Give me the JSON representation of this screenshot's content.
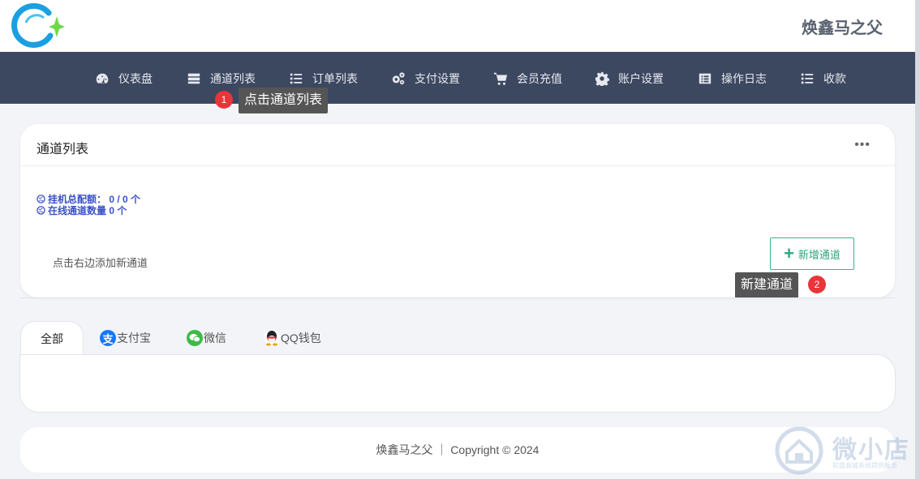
{
  "brand": {
    "name": "焕鑫马之父"
  },
  "nav": {
    "items": [
      {
        "label": "仪表盘",
        "icon": "dashboard-icon"
      },
      {
        "label": "通道列表",
        "icon": "table-icon"
      },
      {
        "label": "订单列表",
        "icon": "list-icon"
      },
      {
        "label": "支付设置",
        "icon": "gears-icon"
      },
      {
        "label": "会员充值",
        "icon": "cart-icon"
      },
      {
        "label": "账户设置",
        "icon": "gear-icon"
      },
      {
        "label": "操作日志",
        "icon": "log-icon"
      },
      {
        "label": "收款",
        "icon": "list-icon"
      }
    ]
  },
  "tooltips": {
    "step1": {
      "number": "1",
      "text": "点击通道列表"
    },
    "step2": {
      "number": "2",
      "text": "新建通道"
    }
  },
  "card": {
    "title": "通道列表",
    "more_label": "•••",
    "stats": [
      {
        "label": "挂机总配额：",
        "value": "0 / 0 个"
      },
      {
        "label": "在线通道数量",
        "value": "0 个"
      }
    ],
    "hint": "点击右边添加新通道",
    "add_button": {
      "label": "新增通道",
      "icon": "plus-icon"
    }
  },
  "tabs": [
    {
      "label": "全部",
      "icon": ""
    },
    {
      "label": "支付宝",
      "icon": "alipay-icon",
      "glyph": "支"
    },
    {
      "label": "微信",
      "icon": "wechat-icon"
    },
    {
      "label": "QQ钱包",
      "icon": "qq-icon"
    }
  ],
  "footer": {
    "text": "焕鑫马之父 ｜ Copyright © 2024"
  },
  "watermark": {
    "title": "微小店",
    "subtitle": "软盘商城系统提供服务"
  },
  "colors": {
    "nav_bg": "#3c4760",
    "accent_green": "#35b58b",
    "stat_blue": "#3b52c7",
    "badge_red": "#e8353a",
    "alipay_blue": "#1677ff",
    "wechat_green": "#3dbb4a"
  }
}
